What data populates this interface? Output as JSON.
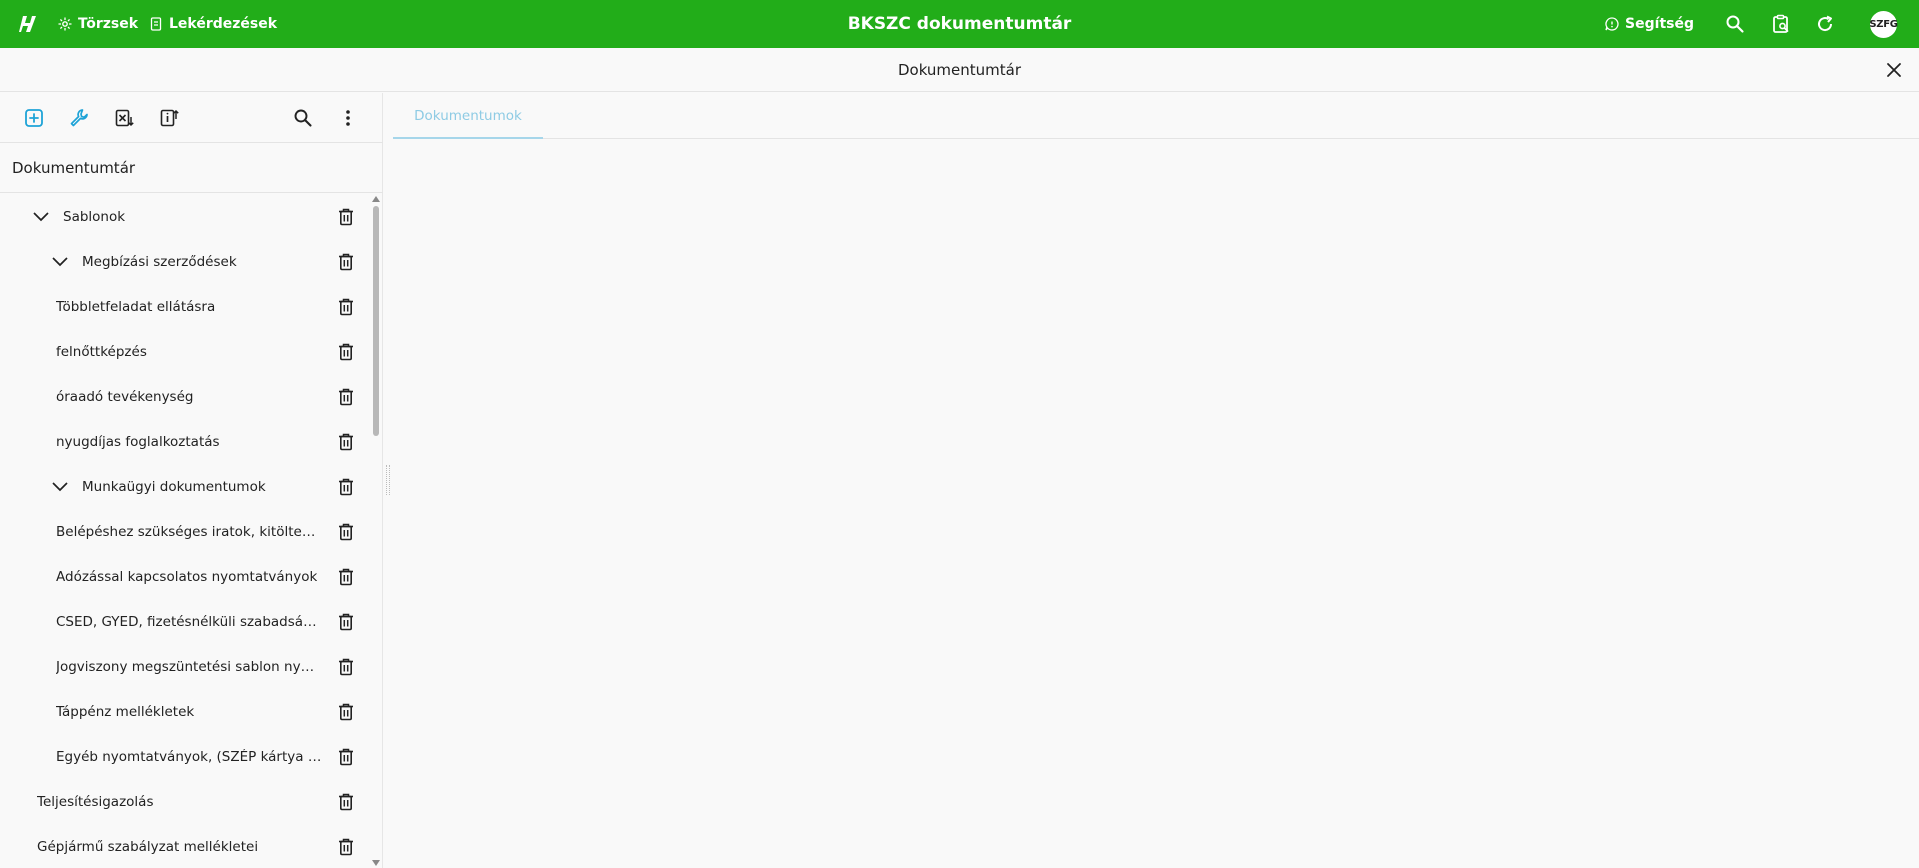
{
  "topbar": {
    "nav": [
      {
        "label": "Törzsek",
        "icon": "settings-sparkle-icon"
      },
      {
        "label": "Lekérdezések",
        "icon": "document-icon"
      }
    ],
    "app_title": "BKSZC dokumentumtár",
    "help_label": "Segítség",
    "icons": [
      "search-icon",
      "clipboard-search-icon",
      "refresh-icon"
    ],
    "avatar_initials": "SZFG",
    "color": "#22ad19"
  },
  "titlebar": {
    "title": "Dokumentumtár"
  },
  "left_panel": {
    "toolbar": [
      "add-icon",
      "wrench-icon",
      "excel-export-icon",
      "info-upload-icon",
      "search-icon",
      "more-vert-icon"
    ],
    "tree_title": "Dokumentumtár",
    "items": [
      {
        "label": "Sablonok",
        "level": 1,
        "expandable": true
      },
      {
        "label": "Megbízási szerződések",
        "level": 2,
        "expandable": true
      },
      {
        "label": "Többletfeladat ellátásra",
        "level": 3,
        "expandable": false
      },
      {
        "label": "felnőttképzés",
        "level": 3,
        "expandable": false
      },
      {
        "label": "óraadó tevékenység",
        "level": 3,
        "expandable": false
      },
      {
        "label": "nyugdíjas foglalkoztatás",
        "level": 3,
        "expandable": false
      },
      {
        "label": "Munkaügyi dokumentumok",
        "level": 2,
        "expandable": true
      },
      {
        "label": "Belépéshez szükséges iratok, kitöltendő nyomtatványok",
        "level": 3,
        "expandable": false
      },
      {
        "label": "Adózással kapcsolatos nyomtatványok",
        "level": 3,
        "expandable": false
      },
      {
        "label": "CSED, GYED, fizetésnélküli szabadság nyomtatványok",
        "level": 3,
        "expandable": false
      },
      {
        "label": "Jogviszony megszüntetési sablon nyomtatványok",
        "level": 3,
        "expandable": false
      },
      {
        "label": "Táppénz mellékletek",
        "level": 3,
        "expandable": false
      },
      {
        "label": "Egyéb nyomtatványok, (SZÉP kártya nyomtatványok)",
        "level": 3,
        "expandable": false
      },
      {
        "label": "Teljesítésigazolás",
        "level": 2,
        "expandable": false
      },
      {
        "label": "Gépjármű szabályzat mellékletei",
        "level": 2,
        "expandable": false
      }
    ]
  },
  "right_panel": {
    "tabs": [
      {
        "label": "Dokumentumok",
        "active": true
      }
    ]
  }
}
